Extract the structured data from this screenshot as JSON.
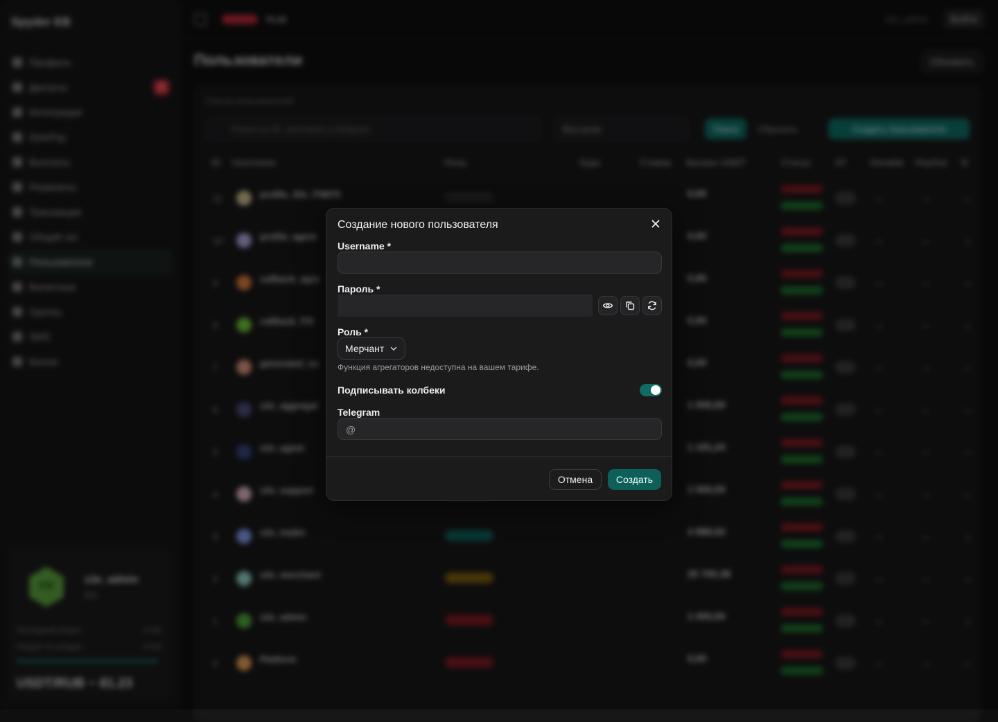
{
  "background": {
    "brand": "Spyder EB",
    "nav": [
      {
        "label": "Профиль"
      },
      {
        "label": "Диспуты",
        "badge": "9"
      },
      {
        "label": "Интеграция"
      },
      {
        "label": "DemPay"
      },
      {
        "label": "Выплаты"
      },
      {
        "label": "Реквизиты"
      },
      {
        "label": "Транзакции"
      },
      {
        "label": "Общий чат"
      },
      {
        "label": "Пользователи",
        "active": true
      },
      {
        "label": "Валютные"
      },
      {
        "label": "Группы"
      },
      {
        "label": "SMS"
      },
      {
        "label": "Билли"
      }
    ],
    "user_card": {
      "initials": "FR",
      "name": "s3x_admin",
      "id": "ID1",
      "row1_label": "Последний оборот",
      "row1_value": "0.000",
      "row2_label": "Оборот за сегодня",
      "row2_value": "0.000",
      "rate": "USDT/RUB ~ 81.23"
    },
    "topbar": {
      "text": "RUB",
      "user": "s3x_admin",
      "exit": "Выйти"
    },
    "page_title": "Пользователи",
    "refresh": "Обновить",
    "panel_caption": "Список пользователей",
    "search_placeholder": "Поиск по ID, username и telegram",
    "roles_select": "Все роли",
    "search_btn": "Поиск",
    "reset_btn": "Сбросить",
    "create_user_btn": "Создать пользователя",
    "columns": [
      "ID",
      "Username",
      "Роль",
      "Курс",
      "Ставки",
      "Баланс USDT",
      "Статус",
      "ST",
      "Onrable",
      "PayOut",
      "N"
    ],
    "rows": [
      {
        "id": "11",
        "name": "profile_33s_f78870",
        "balance": "0,00"
      },
      {
        "id": "10",
        "name": "profile_agent",
        "balance": "0,00"
      },
      {
        "id": "9",
        "name": "callback_agre",
        "balance": "0,00"
      },
      {
        "id": "8",
        "name": "callback_f76",
        "balance": "0,00"
      },
      {
        "id": "7",
        "name": "generated_us",
        "balance": "0,00"
      },
      {
        "id": "6",
        "name": "s3x_aggregat",
        "balance": "1 000,00"
      },
      {
        "id": "5",
        "name": "s3x_agent",
        "balance": "1 191,24"
      },
      {
        "id": "4",
        "name": "s3x_support",
        "balance": "1 000,00"
      },
      {
        "id": "3",
        "name": "s3x_trader",
        "balance": "4 989,02"
      },
      {
        "id": "2",
        "name": "s3x_merchant",
        "balance": "25 700,38"
      },
      {
        "id": "1",
        "name": "s3x_admin",
        "balance": "1 000,00"
      },
      {
        "id": "0",
        "name": "Platform",
        "balance": "0,00"
      }
    ]
  },
  "modal": {
    "title": "Создание нового пользователя",
    "username_label": "Username *",
    "username_value": "",
    "password_label": "Пароль *",
    "password_value": "",
    "role_label": "Роль *",
    "role_selected": "Мерчант",
    "role_hint": "Функция агрегаторов недоступна на вашем тарифе.",
    "sign_callbacks_label": "Подписывать колбеки",
    "sign_callbacks_enabled": true,
    "telegram_label": "Telegram",
    "telegram_prefix": "@",
    "telegram_value": "",
    "cancel": "Отмена",
    "create": "Создать"
  },
  "colors": {
    "accent": "#0f6b63",
    "danger": "#b52a33",
    "surface": "#1b1b1c",
    "background": "#0f0f10"
  },
  "icons": {
    "close": "close-icon",
    "show_password": "eye-icon",
    "copy_password": "copy-icon",
    "generate_password": "refresh-icon",
    "dropdown": "chevron-down-icon"
  }
}
